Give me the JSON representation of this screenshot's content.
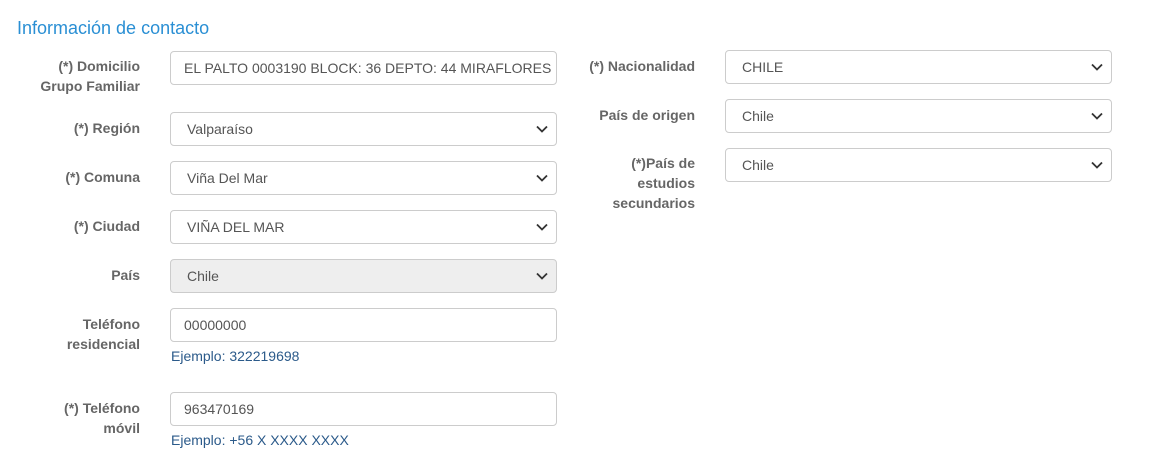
{
  "section": {
    "title": "Información de contacto"
  },
  "left": {
    "domicilio": {
      "label_line1": "(*) Domicilio",
      "label_line2": "Grupo Familiar",
      "value": "EL PALTO 0003190 BLOCK: 36 DEPTO: 44 MIRAFLORES"
    },
    "region": {
      "label": "(*) Región",
      "value": "Valparaíso"
    },
    "comuna": {
      "label": "(*) Comuna",
      "value": "Viña Del Mar"
    },
    "ciudad": {
      "label": "(*) Ciudad",
      "value": "VIÑA DEL MAR"
    },
    "pais": {
      "label": "País",
      "value": "Chile"
    },
    "telefono_residencial": {
      "label_line1": "Teléfono",
      "label_line2": "residencial",
      "value": "00000000",
      "hint": "Ejemplo: 322219698"
    },
    "telefono_movil": {
      "label_line1": "(*) Teléfono",
      "label_line2": "móvil",
      "value": "963470169",
      "hint": "Ejemplo: +56 X XXXX XXXX"
    }
  },
  "right": {
    "nacionalidad": {
      "label": "(*) Nacionalidad",
      "value": "CHILE"
    },
    "pais_origen": {
      "label": "País de origen",
      "value": "Chile"
    },
    "pais_estudios": {
      "label_line1": "(*)País de",
      "label_line2": "estudios",
      "label_line3": "secundarios",
      "value": "Chile"
    }
  },
  "colors": {
    "title": "#2a8fd4",
    "hint": "#2b5a8a",
    "label": "#666666",
    "border": "#cccccc",
    "disabled_bg": "#eeeeee"
  },
  "icons": {
    "select_arrow": "chevron-down-icon"
  }
}
